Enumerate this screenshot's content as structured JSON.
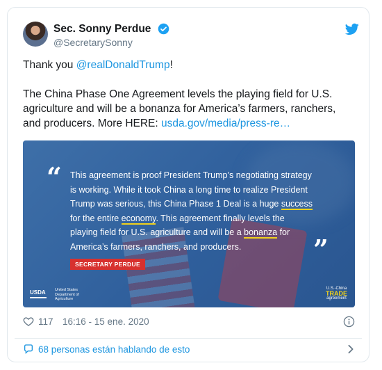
{
  "tweet": {
    "name": "Sec. Sonny Perdue",
    "handle": "@SecretarySonny",
    "line1_prefix": "Thank you ",
    "mention": "@realDonaldTrump",
    "line1_suffix": "!",
    "body": "The China Phase One Agreement levels the playing field for U.S. agriculture and will be a bonanza for America’s farmers, ranchers, and producers. More HERE: ",
    "link": "usda.gov/media/press-re…"
  },
  "media": {
    "quote_open": "“",
    "quote_close": "”",
    "q1": "This agreement is proof President Trump’s negotiating strategy is working. While it took China a long time to realize President Trump was serious, this China Phase 1 Deal is a huge ",
    "q_success": "success",
    "q2": " for the entire ",
    "q_economy": "economy",
    "q3": ". This agreement finally levels the playing field for U.S. agriculture and will be a ",
    "q_bonanza": "bonanza",
    "q4": " for America’s farmers, ranchers, and producers.",
    "badge": "SECRETARY PERDUE",
    "usda_mark": "USDA",
    "usda_sub": "United States Department of Agriculture",
    "trade_top": "U.S.-China",
    "trade_big": "TRADE",
    "trade_bottom": "agreement",
    "highlight_color": "#f2d21b"
  },
  "meta": {
    "likes": "117",
    "timestamp": "16:16 - 15 ene. 2020"
  },
  "footer": {
    "text": "68 personas están hablando de esto"
  },
  "icons": {
    "verified": "verified-icon",
    "bird": "twitter-bird-icon",
    "heart": "heart-icon",
    "info": "info-icon",
    "bubble": "speech-bubble-icon",
    "chevron": "chevron-right-icon"
  },
  "colors": {
    "link": "#1b95e0",
    "secondary_text": "#657786",
    "badge_red": "#d7312f"
  }
}
